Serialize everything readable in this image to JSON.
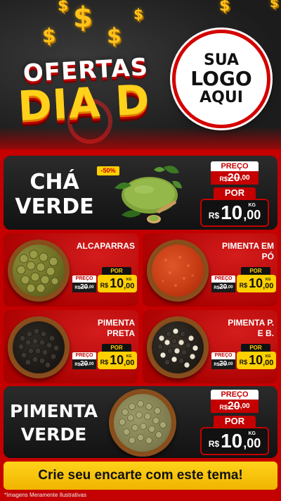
{
  "header": {
    "banner_line1": "OFERTAS",
    "banner_line2": "DIA D",
    "logo_placeholder": [
      "SUA",
      "LOGO",
      "AQUI"
    ]
  },
  "featured": [
    {
      "name_line1": "CHÁ",
      "name_line2": "VERDE",
      "discount_badge": "-50%",
      "old_label": "PREÇO",
      "old_currency": "R$",
      "old_int": "20",
      "old_cents": ",00",
      "new_label": "POR",
      "new_currency": "R$",
      "new_int": "10",
      "new_cents": ",00",
      "unit": "KG"
    },
    {
      "name_line1": "PIMENTA",
      "name_line2": "VERDE",
      "old_label": "PREÇO",
      "old_currency": "R$",
      "old_int": "20",
      "old_cents": ",00",
      "new_label": "POR",
      "new_currency": "R$",
      "new_int": "10",
      "new_cents": ",00",
      "unit": "KG"
    }
  ],
  "products": [
    {
      "name_line1": "ALCAPARRAS",
      "name_line2": "",
      "old_label": "PREÇO",
      "old_currency": "R$",
      "old_int": "20",
      "old_cents": ",00",
      "new_label": "POR",
      "new_currency": "R$",
      "new_int": "10",
      "new_cents": ",00",
      "unit": "KG"
    },
    {
      "name_line1": "PIMENTA EM",
      "name_line2": "PÓ",
      "old_label": "PREÇO",
      "old_currency": "R$",
      "old_int": "20",
      "old_cents": ",00",
      "new_label": "POR",
      "new_currency": "R$",
      "new_int": "10",
      "new_cents": ",00",
      "unit": "KG"
    },
    {
      "name_line1": "PIMENTA",
      "name_line2": "PRETA",
      "old_label": "PREÇO",
      "old_currency": "R$",
      "old_int": "20",
      "old_cents": ",00",
      "new_label": "POR",
      "new_currency": "R$",
      "new_int": "10",
      "new_cents": ",00",
      "unit": "KG"
    },
    {
      "name_line1": "PIMENTA P.",
      "name_line2": "E B.",
      "old_label": "PREÇO",
      "old_currency": "R$",
      "old_int": "20",
      "old_cents": ",00",
      "new_label": "POR",
      "new_currency": "R$",
      "new_int": "10",
      "new_cents": ",00",
      "unit": "KG"
    }
  ],
  "footer": {
    "cta_label": "Crie seu encarte com este tema!",
    "disclaimer": "*Imagens Meramente Ilustrativas"
  },
  "colors": {
    "brand_red": "#c40000",
    "accent_yellow": "#ffd000",
    "dark": "#1a1a1a"
  },
  "icons": [
    "dollar-sign-icon",
    "tea-leaf-icon"
  ]
}
